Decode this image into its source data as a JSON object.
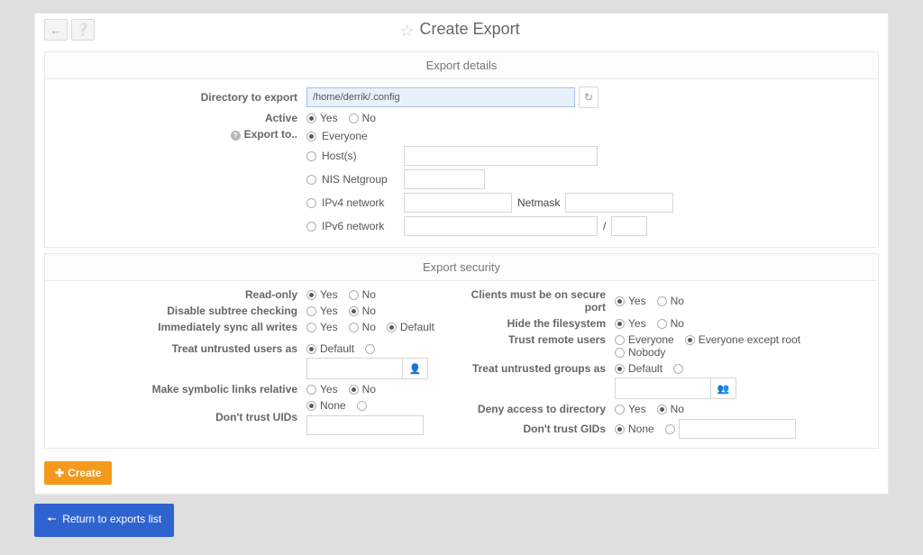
{
  "header": {
    "title": "Create Export"
  },
  "details": {
    "heading": "Export details",
    "dir_label": "Directory to export",
    "dir_value": "/home/derrik/.config",
    "active_label": "Active",
    "yes": "Yes",
    "no": "No",
    "exportto_label": "Export to..",
    "everyone": "Everyone",
    "hosts": "Host(s)",
    "nis": "NIS Netgroup",
    "ipv4": "IPv4 network",
    "netmask": "Netmask",
    "ipv6": "IPv6 network",
    "slash": "/"
  },
  "security": {
    "heading": "Export security",
    "readonly": "Read-only",
    "disable_subtree": "Disable subtree checking",
    "immed_sync": "Immediately sync all writes",
    "default": "Default",
    "treat_users": "Treat untrusted users as",
    "symlinks": "Make symbolic links relative",
    "notrust_uids": "Don't trust UIDs",
    "none": "None",
    "clients_secure": "Clients must be on secure port",
    "hide_fs": "Hide the filesystem",
    "trust_remote": "Trust remote users",
    "everyone_opt": "Everyone",
    "except_root": "Everyone except root",
    "nobody": "Nobody",
    "treat_groups": "Treat untrusted groups as",
    "deny_access": "Deny access to directory",
    "notrust_gids": "Don't trust GIDs"
  },
  "buttons": {
    "create": "Create",
    "return": "Return to exports list"
  }
}
